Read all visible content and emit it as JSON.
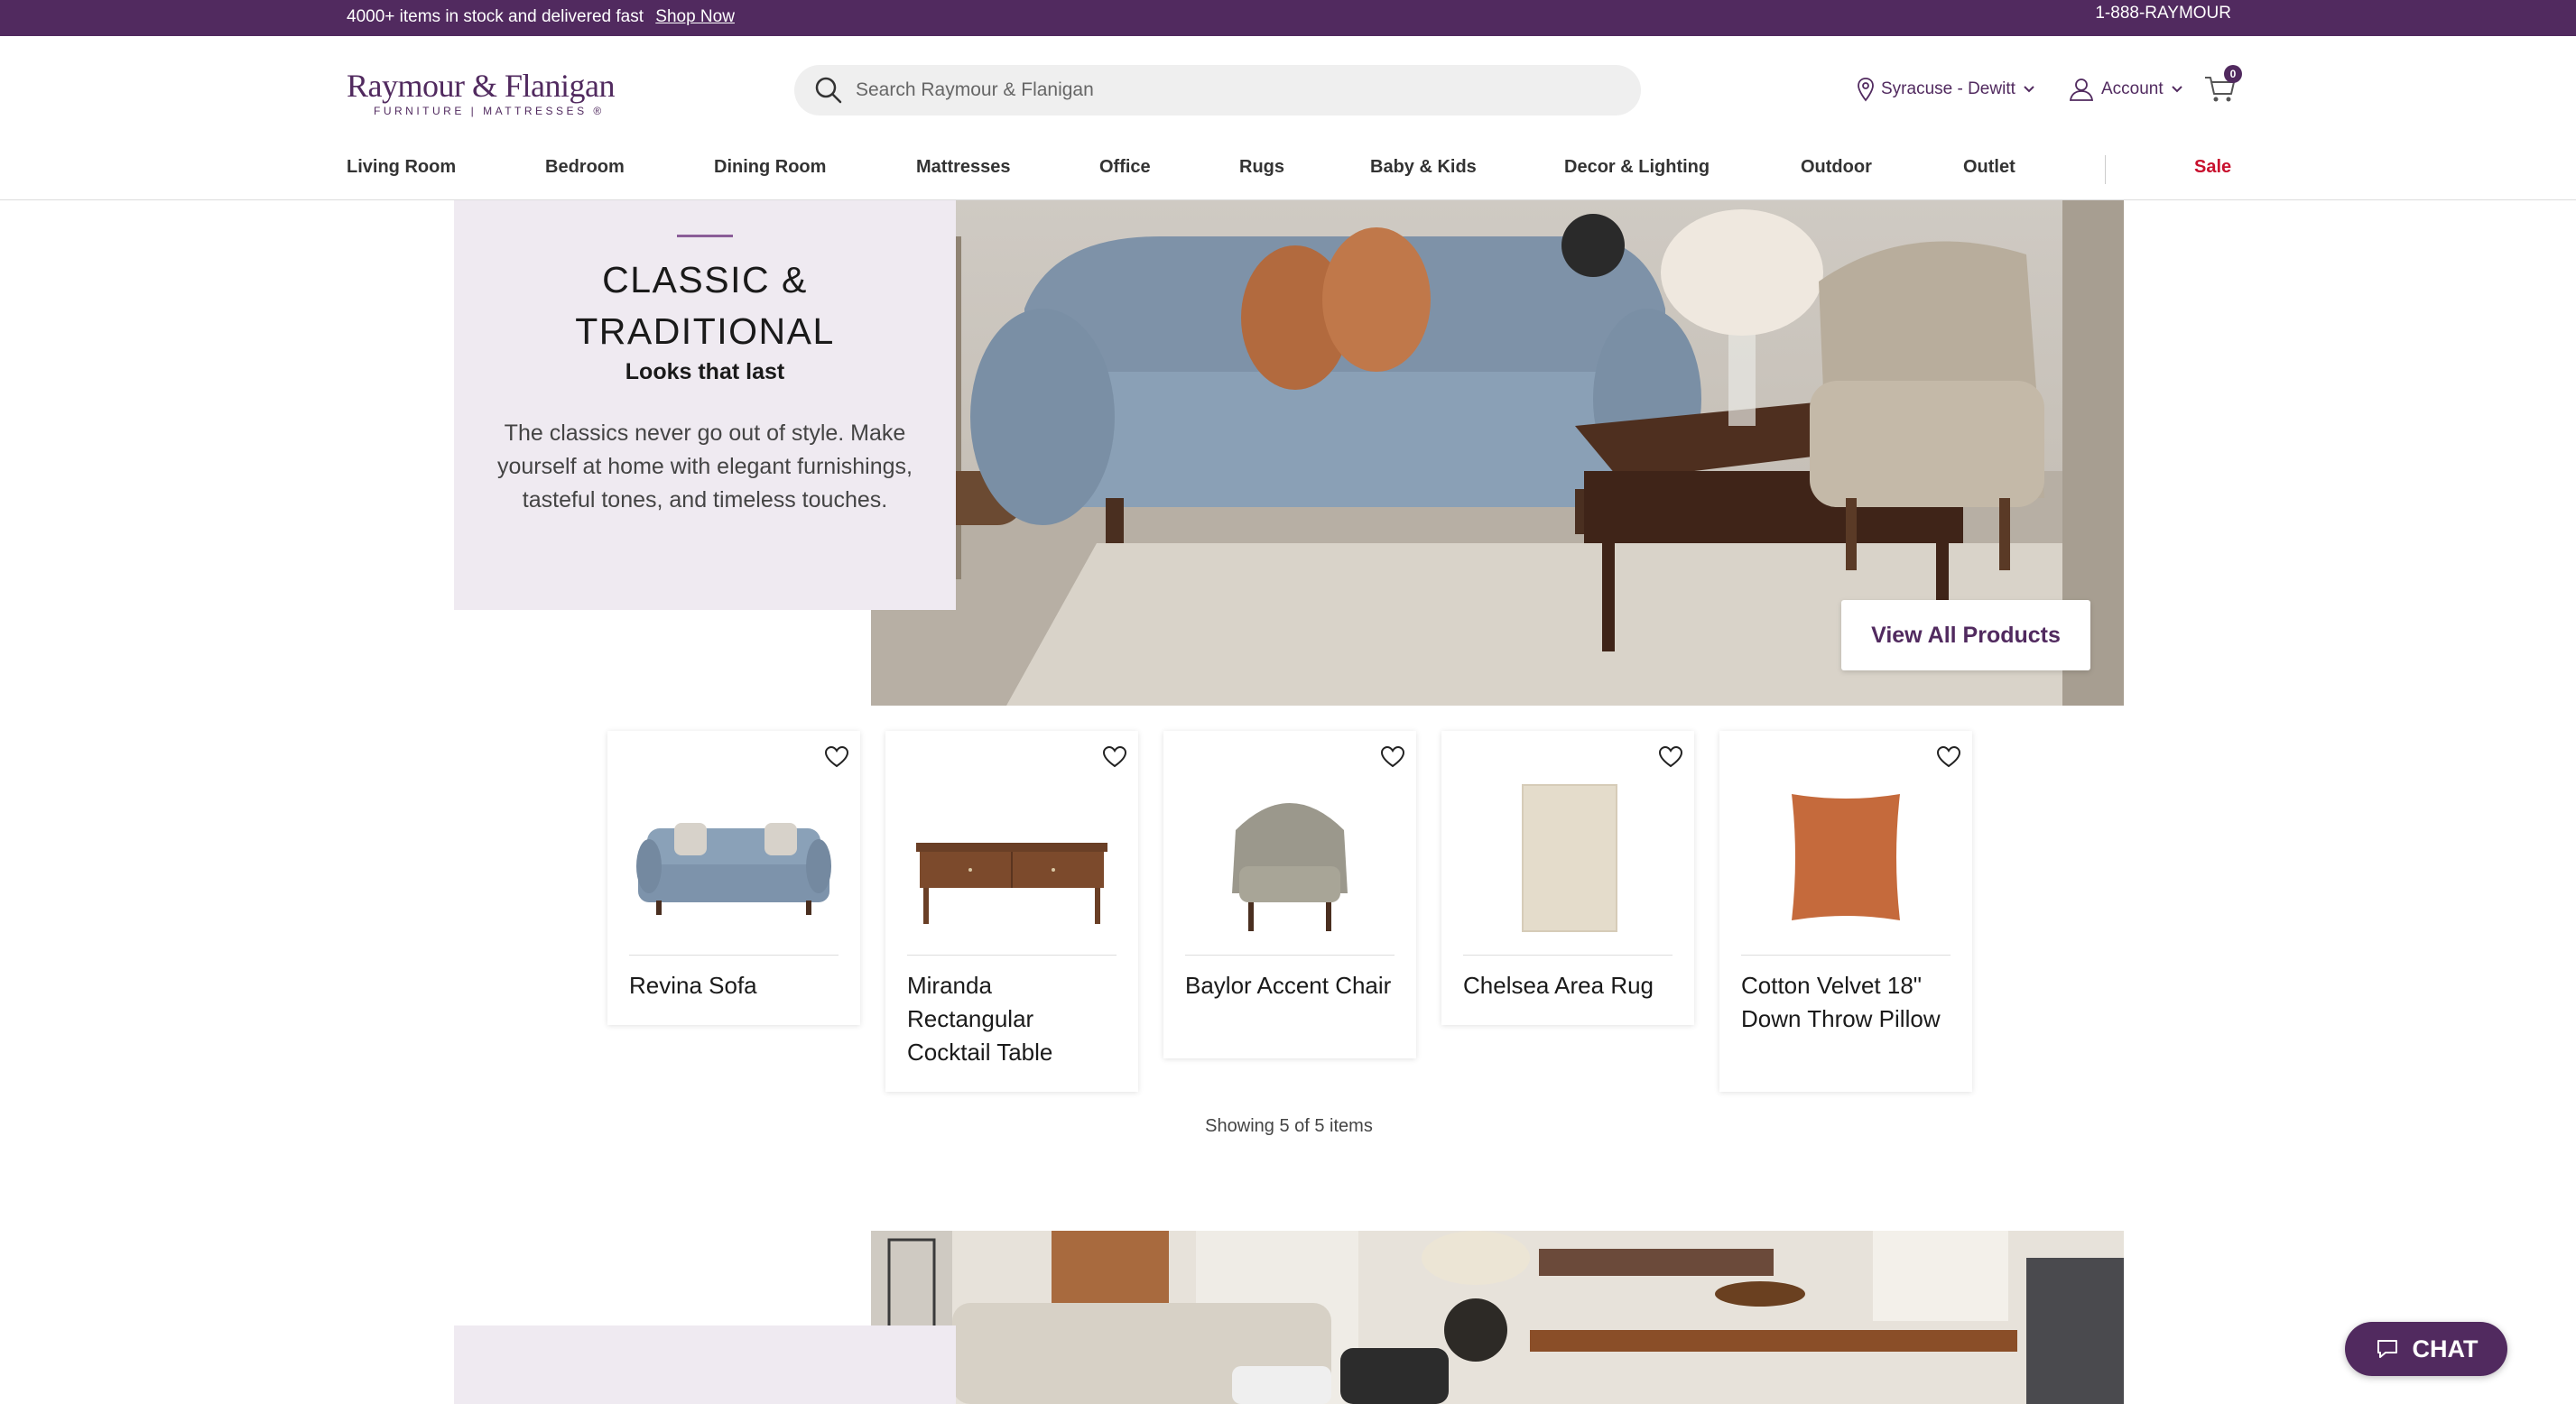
{
  "promo": {
    "text": "4000+ items in stock and delivered fast",
    "link": "Shop Now",
    "phone": "1-888-RAYMOUR"
  },
  "header": {
    "logo_main": "Raymour & Flanigan",
    "logo_sub": "FURNITURE | MATTRESSES ®",
    "search_placeholder": "Search Raymour & Flanigan",
    "store": "Syracuse - Dewitt",
    "account": "Account",
    "cart_count": "0"
  },
  "nav": {
    "items": [
      "Living Room",
      "Bedroom",
      "Dining Room",
      "Mattresses",
      "Office",
      "Rugs",
      "Baby & Kids",
      "Decor & Lighting",
      "Outdoor",
      "Outlet"
    ],
    "sale": "Sale"
  },
  "hero": {
    "title": "CLASSIC & TRADITIONAL",
    "subtitle": "Looks that last",
    "description": "The classics never go out of style. Make yourself at home with elegant furnishings, tasteful tones, and timeless touches.",
    "button": "View All Products"
  },
  "products": [
    {
      "name": "Revina Sofa",
      "icon": "sofa"
    },
    {
      "name": "Miranda Rectangular Cocktail Table",
      "icon": "coffee-table"
    },
    {
      "name": "Baylor Accent Chair",
      "icon": "armchair"
    },
    {
      "name": "Chelsea Area Rug",
      "icon": "rug"
    },
    {
      "name": "Cotton Velvet 18\" Down Throw Pillow",
      "icon": "pillow"
    }
  ],
  "showing": "Showing 5 of 5 items",
  "chat": "CHAT",
  "colors": {
    "brand": "#512a5f",
    "sale": "#c8102e",
    "card_bg": "#efeaf1"
  }
}
